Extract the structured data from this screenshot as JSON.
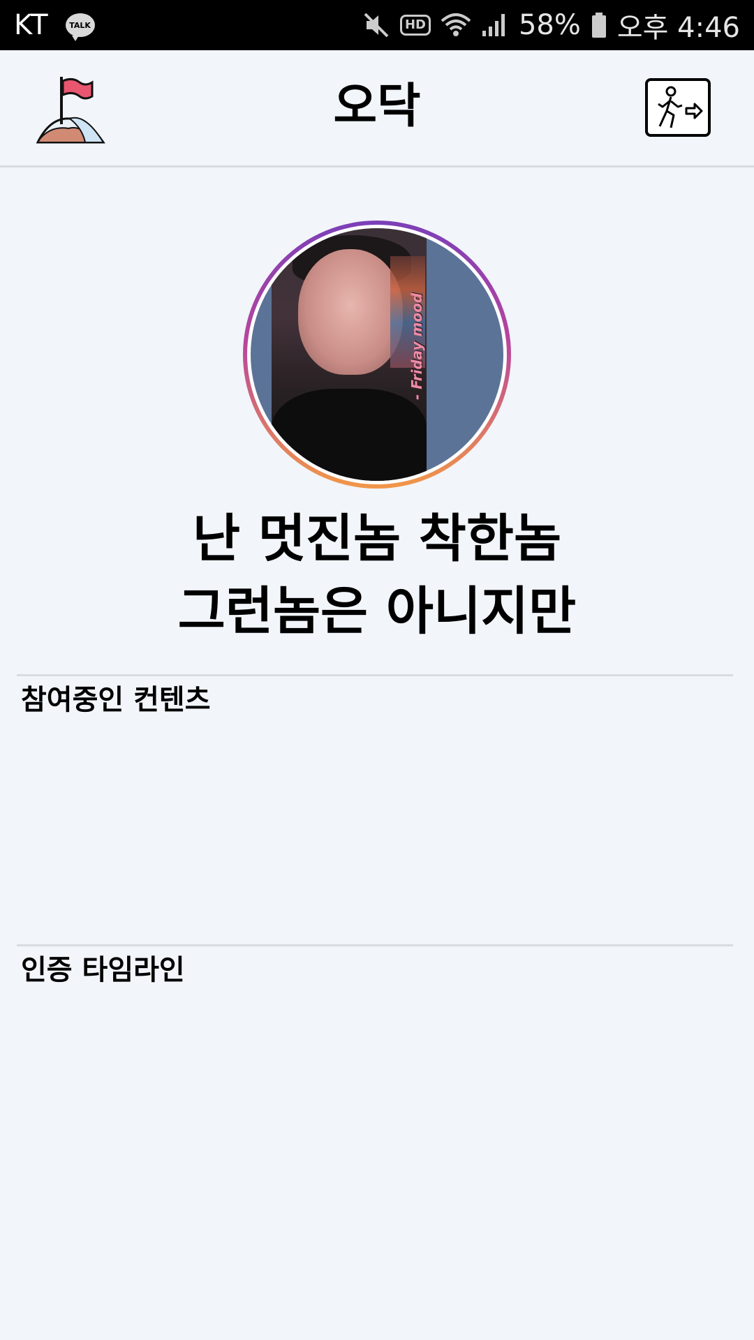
{
  "status_bar": {
    "carrier": "KT",
    "talk_icon_label": "TALK",
    "hd_label": "HD",
    "battery": "58%",
    "time": "오후 4:46",
    "icons": [
      "talk-icon",
      "mute-icon",
      "hd-icon",
      "wifi-icon",
      "signal-icon",
      "battery-icon"
    ]
  },
  "header": {
    "title": "오닥",
    "logo_icon": "flag-on-mountain-icon",
    "exit_icon": "exit-person-icon"
  },
  "profile": {
    "photo_caption": "- Friday mood",
    "message_line1": "난 멋진놈 착한놈",
    "message_line2": "그런놈은 아니지만"
  },
  "sections": {
    "contents_title": "참여중인 컨텐츠",
    "timeline_title": "인증 타임라인"
  },
  "colors": {
    "background": "#f2f5f9",
    "ring_top": "#7b3fb8",
    "ring_bottom": "#f19748",
    "flag": "#e8566f"
  }
}
